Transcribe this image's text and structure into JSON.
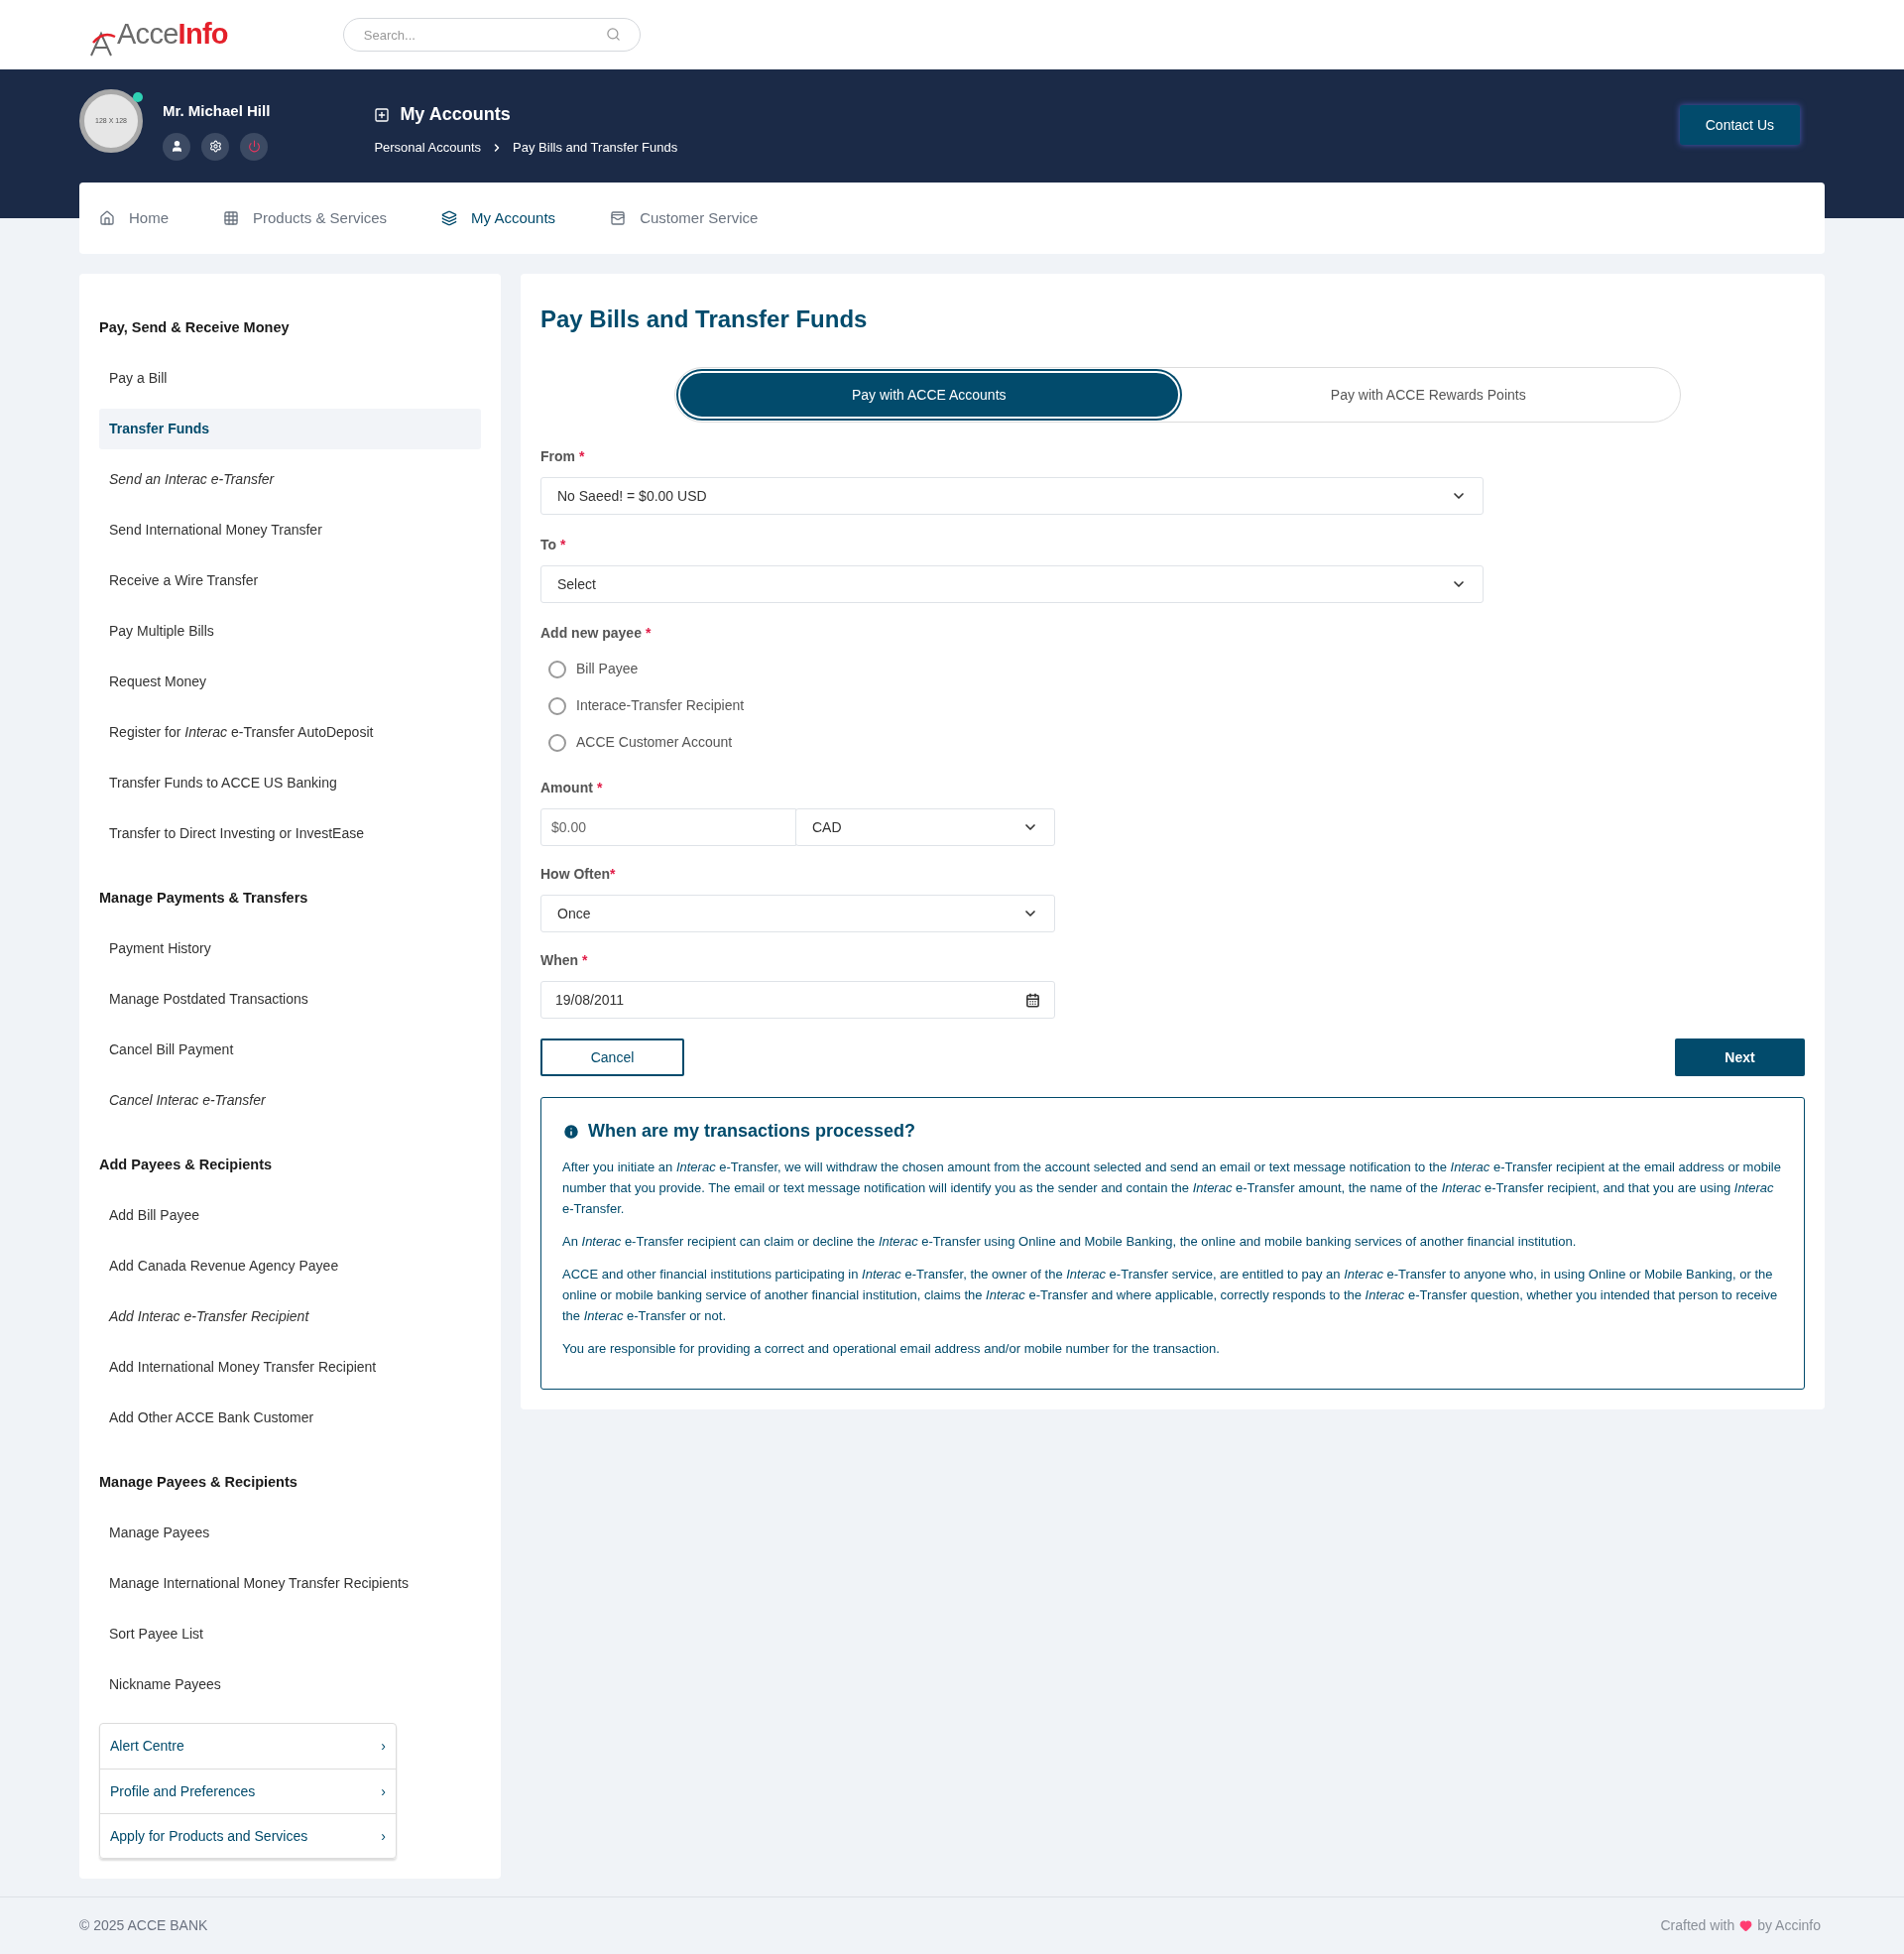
{
  "header": {
    "logo": {
      "part1": "Acce",
      "part2": "Info"
    },
    "search": {
      "placeholder": "Search..."
    }
  },
  "profile": {
    "avatar_text": "128 X 128",
    "online": true,
    "name": "Mr. Michael Hill"
  },
  "page_heading": {
    "title": "My Accounts",
    "breadcrumb": [
      "Personal Accounts",
      "Pay Bills and Transfer Funds"
    ]
  },
  "contact_button": "Contact Us",
  "nav": [
    {
      "label": "Home",
      "selected": false
    },
    {
      "label": "Products & Services",
      "selected": false
    },
    {
      "label": "My Accounts",
      "selected": true
    },
    {
      "label": "Customer Service",
      "selected": false
    }
  ],
  "sidebar": {
    "sections": [
      {
        "title": "Pay, Send & Receive Money",
        "items": [
          {
            "label": "Pay a Bill",
            "selected": false,
            "italic": false
          },
          {
            "label": "Transfer Funds",
            "selected": true,
            "italic": false
          },
          {
            "label": "Send an Interac e-Transfer",
            "selected": false,
            "italic": true
          },
          {
            "label": "Send International Money Transfer",
            "selected": false,
            "italic": false
          },
          {
            "label": "Receive a Wire Transfer",
            "selected": false,
            "italic": false
          },
          {
            "label": "Pay Multiple Bills",
            "selected": false,
            "italic": false
          },
          {
            "label": "Request Money",
            "selected": false,
            "italic": false
          },
          {
            "label": "Register for *Interac* e-Transfer AutoDeposit",
            "selected": false,
            "italic": false
          },
          {
            "label": "Transfer Funds to ACCE US Banking",
            "selected": false,
            "italic": false
          },
          {
            "label": "Transfer to Direct Investing or InvestEase",
            "selected": false,
            "italic": false
          }
        ]
      },
      {
        "title": "Manage Payments & Transfers",
        "items": [
          {
            "label": "Payment History",
            "selected": false,
            "italic": false
          },
          {
            "label": "Manage Postdated Transactions",
            "selected": false,
            "italic": false
          },
          {
            "label": "Cancel Bill Payment",
            "selected": false,
            "italic": false
          },
          {
            "label": "Cancel Interac e-Transfer",
            "selected": false,
            "italic": true
          }
        ]
      },
      {
        "title": "Add Payees & Recipients",
        "items": [
          {
            "label": "Add Bill Payee",
            "selected": false,
            "italic": false
          },
          {
            "label": "Add Canada Revenue Agency Payee",
            "selected": false,
            "italic": false
          },
          {
            "label": "Add Interac e-Transfer Recipient",
            "selected": false,
            "italic": true
          },
          {
            "label": "Add International Money Transfer Recipient",
            "selected": false,
            "italic": false
          },
          {
            "label": "Add Other ACCE Bank Customer",
            "selected": false,
            "italic": false
          }
        ]
      },
      {
        "title": "Manage Payees & Recipients",
        "items": [
          {
            "label": "Manage Payees",
            "selected": false,
            "italic": false
          },
          {
            "label": "Manage International Money Transfer Recipients",
            "selected": false,
            "italic": false
          },
          {
            "label": "Sort Payee List",
            "selected": false,
            "italic": false
          },
          {
            "label": "Nickname Payees",
            "selected": false,
            "italic": false
          }
        ]
      }
    ],
    "links": [
      "Alert Centre",
      "Profile and Preferences",
      "Apply for Products and Services"
    ],
    "link_arrow": "›"
  },
  "main": {
    "title": "Pay Bills and Transfer Funds",
    "pay_tabs": [
      {
        "label": "Pay with ACCE Accounts",
        "selected": true
      },
      {
        "label": "Pay with ACCE Rewards Points",
        "selected": false
      }
    ],
    "from": {
      "label": "From",
      "value": "No Saeed! = $0.00 USD"
    },
    "to": {
      "label": "To",
      "value": "Select"
    },
    "new_payee": {
      "label": "Add new payee",
      "options": [
        {
          "label": "Bill Payee",
          "selected": false
        },
        {
          "label": "Interace-Transfer Recipient",
          "selected": false
        },
        {
          "label": "ACCE Customer Account",
          "selected": false
        }
      ]
    },
    "amount": {
      "label": "Amount",
      "placeholder": "$0.00",
      "currency": "CAD"
    },
    "how_often": {
      "label": "How Often",
      "value": "Once"
    },
    "when": {
      "label": "When",
      "value": "19/08/2011"
    },
    "required_mark": "*",
    "cancel": "Cancel",
    "next": "Next",
    "info": {
      "title": "When are my transactions processed?",
      "paragraphs": [
        "After you initiate an *Interac* e-Transfer, we will withdraw the chosen amount from the account selected and send an email or text message notification to the *Interac* e-Transfer recipient at the email address or mobile number that you provide. The email or text message notification will identify you as the sender and contain the *Interac* e-Transfer amount, the name of the *Interac* e-Transfer recipient, and that you are using *Interac* e-Transfer.",
        "An *Interac* e-Transfer recipient can claim or decline the *Interac* e-Transfer using Online and Mobile Banking, the online and mobile banking services of another financial institution.",
        "ACCE and other financial institutions participating in *Interac* e-Transfer, the owner of the *Interac* e-Transfer service, are entitled to pay an *Interac* e-Transfer to anyone who, in using Online or Mobile Banking, or the online or mobile banking service of another financial institution, claims the *Interac* e-Transfer and where applicable, correctly responds to the *Interac* e-Transfer question, whether you intended that person to receive the *Interac* e-Transfer or not.",
        "You are responsible for providing a correct and operational email address and/or mobile number for the transaction."
      ]
    }
  },
  "footer": {
    "copyright": "© 2025 ACCE BANK",
    "crafted_before": "Crafted with",
    "crafted_after": "by Accinfo"
  }
}
